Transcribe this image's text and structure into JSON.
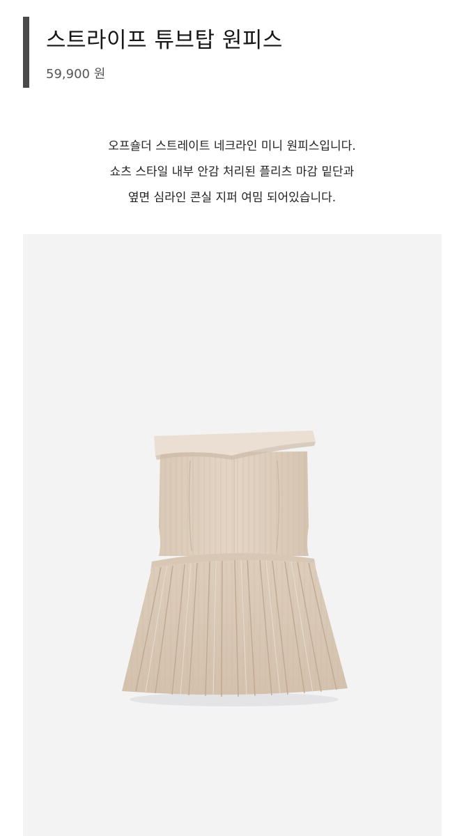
{
  "product": {
    "title": "스트라이프 튜브탑 원피스",
    "price": "59,900 원"
  },
  "description": {
    "lines": [
      "오프숄더 스트레이트 네크라인 미니 원피스입니다.",
      "쇼츠 스타일 내부 안감 처리된 플리츠 마감 밑단과",
      "옆면 심라인 콘실 지퍼 여밈 되어있습니다."
    ]
  },
  "image": {
    "subject": "strapless striped pleated mini dress",
    "background_color": "#f3f3f4",
    "dress_color": "#e2d3c3"
  }
}
